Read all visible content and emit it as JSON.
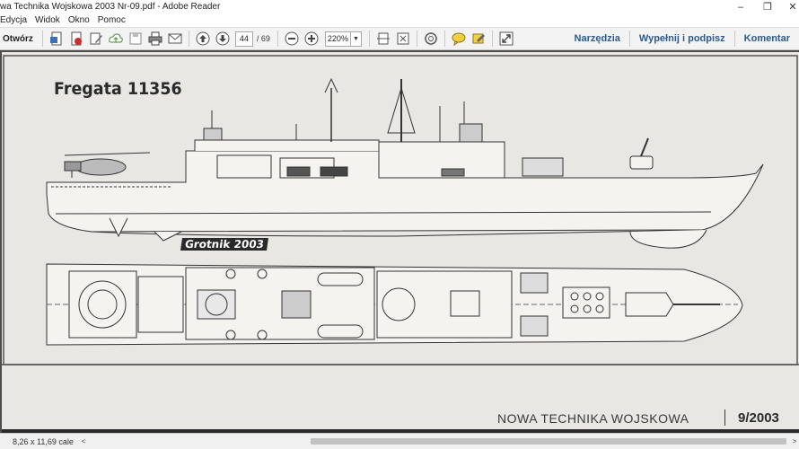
{
  "window": {
    "title": "wa Technika Wojskowa 2003 Nr-09.pdf - Adobe Reader",
    "controls": {
      "minimize": "–",
      "restore": "❐",
      "close": "✕"
    }
  },
  "menu": {
    "items": [
      "Edycja",
      "Widok",
      "Okno",
      "Pomoc"
    ]
  },
  "toolbar": {
    "open_label": "Otwórz",
    "page_current": "44",
    "page_separator": "/",
    "page_total": "69",
    "zoom_value": "220%",
    "right_links": [
      "Narzędzia",
      "Wypełnij i podpisz",
      "Komentar"
    ]
  },
  "document": {
    "drawing_title": "Fregata 11356",
    "signature": "Grotnik 2003",
    "magazine_name": "NOWA TECHNIKA WOJSKOWA",
    "magazine_issue": "9/2003"
  },
  "statusbar": {
    "page_size": "8,26 x 11,69 cale"
  },
  "colors": {
    "toolbar_link": "#2c5a8c",
    "doc_background": "#4d4d4d",
    "page_paper": "#e8e7e3"
  }
}
